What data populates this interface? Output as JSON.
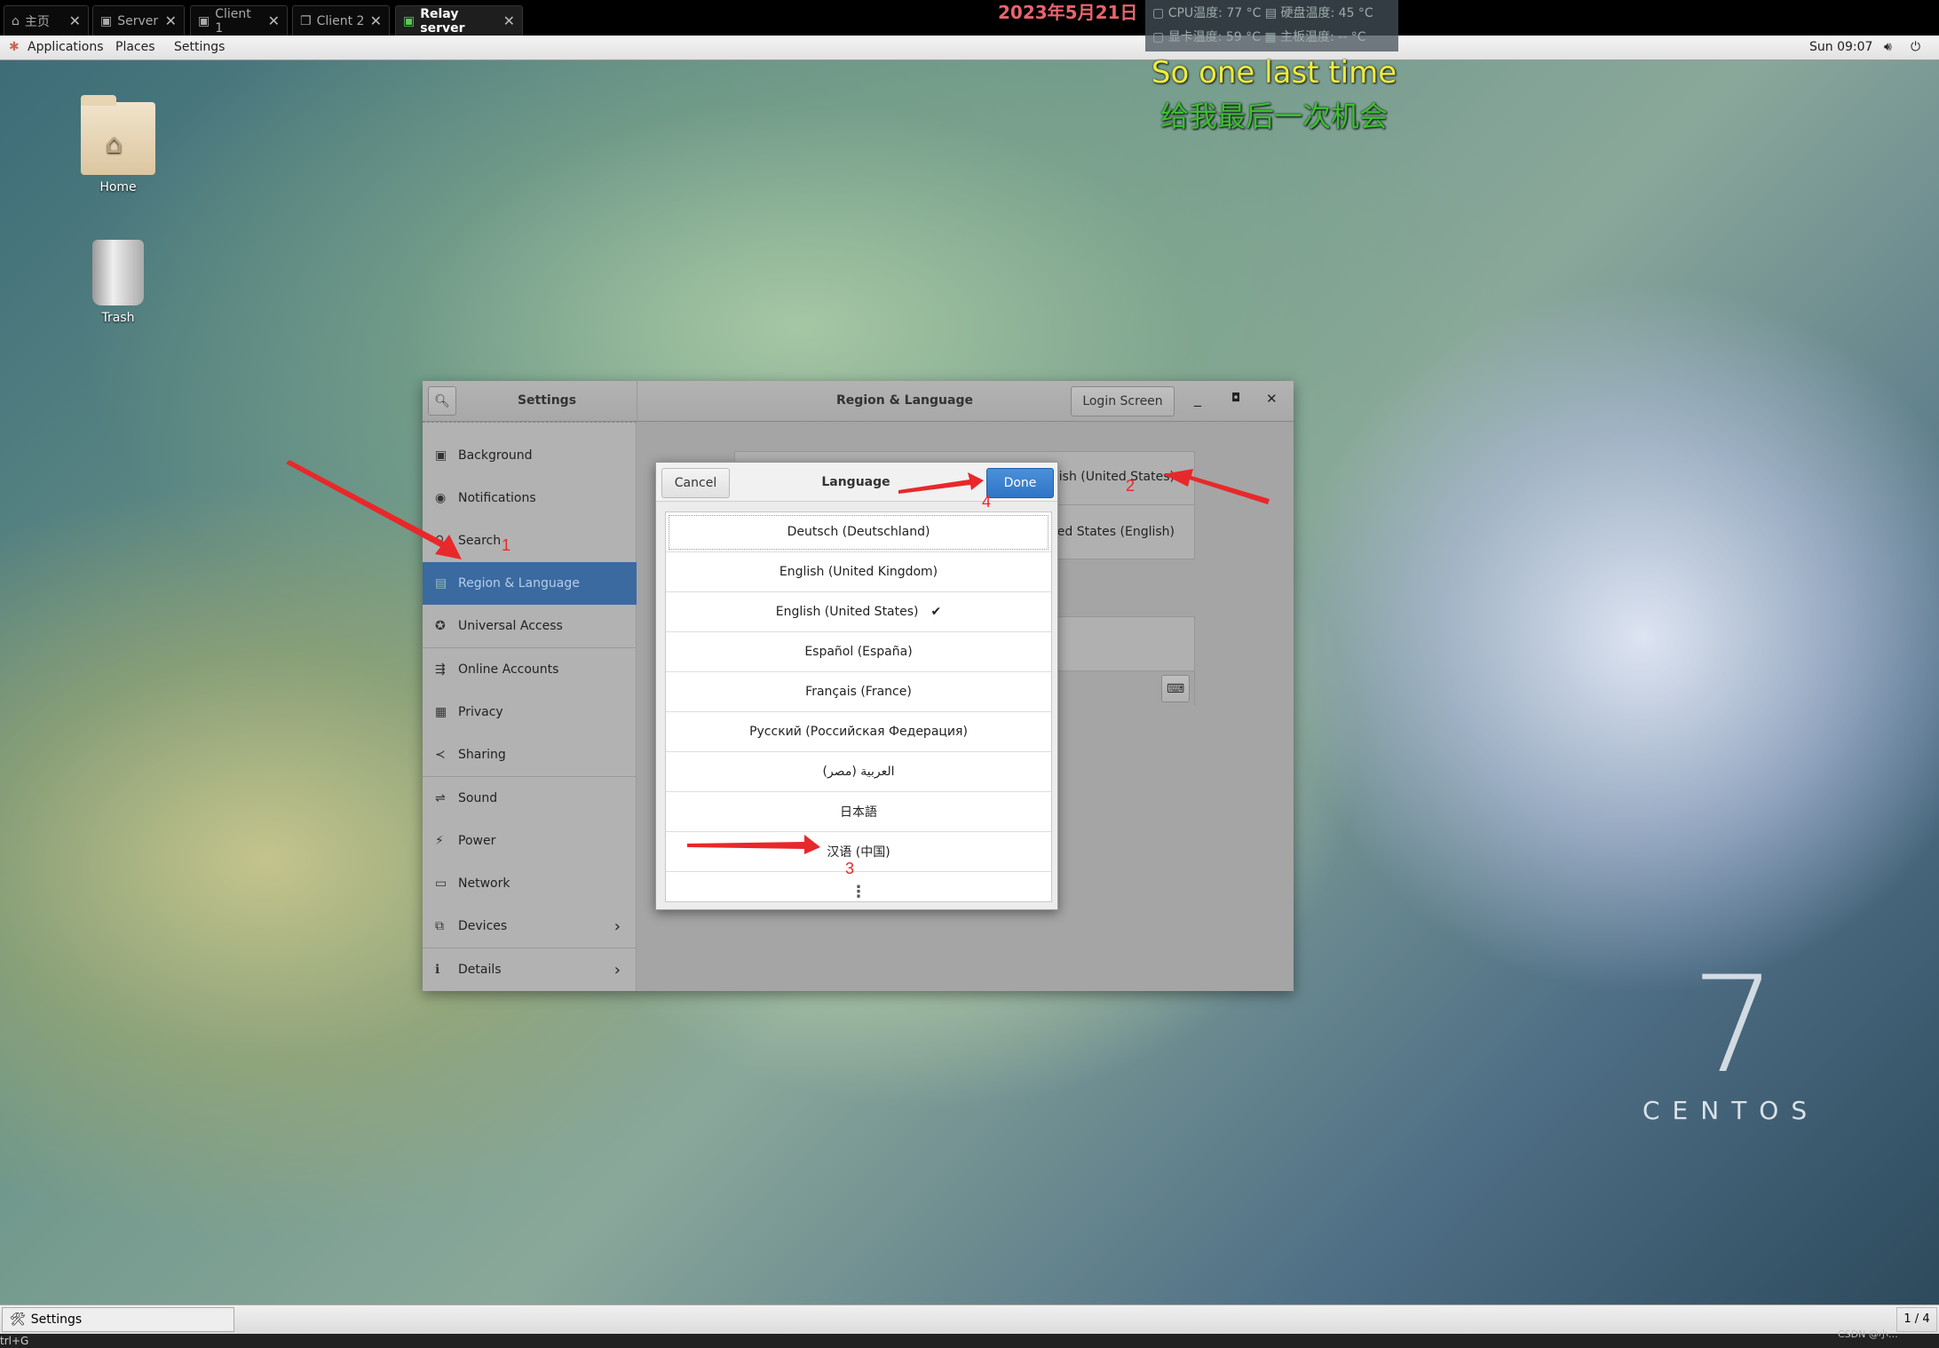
{
  "remote_tabs": [
    {
      "label": "主页",
      "icon": "home-icon"
    },
    {
      "label": "Server",
      "icon": "remote-icon"
    },
    {
      "label": "Client 1",
      "icon": "remote-icon"
    },
    {
      "label": "Client 2",
      "icon": "window-icon"
    },
    {
      "label": "Relay server",
      "icon": "remote-icon",
      "active": true
    }
  ],
  "overlay": {
    "date": "2023年5月21日",
    "cpu_temp": "CPU温度: 77 °C",
    "disk_temp": "硬盘温度: 45 °C",
    "gpu_temp": "显卡温度: 59 °C",
    "board_temp": "主板温度: -- °C",
    "lyric_en": "So one last time",
    "lyric_zh": "给我最后一次机会"
  },
  "top_panel": {
    "applications": "Applications",
    "places": "Places",
    "settings": "Settings",
    "clock": "Sun 09:07"
  },
  "desktop": {
    "home": "Home",
    "trash": "Trash",
    "logo_number": "7",
    "logo_text": "CENTOS"
  },
  "settings": {
    "title": "Settings",
    "panel_title": "Region & Language",
    "login_screen": "Login Screen",
    "sidebar": [
      {
        "label": "Background",
        "icon": "background-icon"
      },
      {
        "label": "Notifications",
        "icon": "notifications-icon"
      },
      {
        "label": "Search",
        "icon": "search-icon"
      },
      {
        "label": "Region & Language",
        "icon": "region-icon",
        "selected": true
      },
      {
        "label": "Universal Access",
        "icon": "accessibility-icon"
      },
      {
        "label": "Online Accounts",
        "icon": "online-accounts-icon"
      },
      {
        "label": "Privacy",
        "icon": "privacy-icon"
      },
      {
        "label": "Sharing",
        "icon": "share-icon"
      },
      {
        "label": "Sound",
        "icon": "sound-icon"
      },
      {
        "label": "Power",
        "icon": "power-icon"
      },
      {
        "label": "Network",
        "icon": "network-icon"
      },
      {
        "label": "Devices",
        "icon": "devices-icon",
        "chevron": true
      },
      {
        "label": "Details",
        "icon": "info-icon",
        "chevron": true
      }
    ],
    "language_value": "glish (United States)",
    "formats_value": "ited States (English)"
  },
  "language_dialog": {
    "title": "Language",
    "cancel": "Cancel",
    "done": "Done",
    "languages": [
      "Deutsch (Deutschland)",
      "English (United Kingdom)",
      "English (United States)",
      "Español (España)",
      "Français (France)",
      "Русский (Российская Федерация)",
      "العربية (مصر)",
      "日本語",
      "汉语 (中国)"
    ],
    "selected": "English (United States)",
    "more": "⋮"
  },
  "annotations": [
    "1",
    "2",
    "3",
    "4"
  ],
  "annotation_color": "#e8282a",
  "taskbar": {
    "window": "Settings",
    "workspace": "1 / 4",
    "watermark": "CSDN @小…",
    "status_left": "trl+G"
  }
}
